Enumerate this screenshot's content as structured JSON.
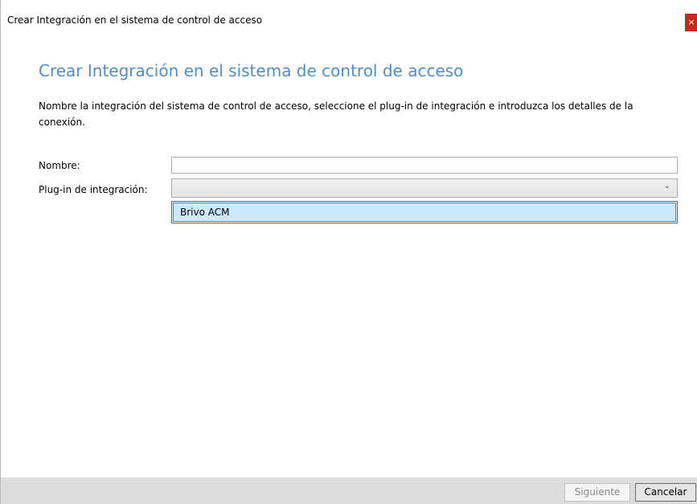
{
  "window": {
    "title": "Crear Integración en el sistema de control de acceso",
    "close_label": "×"
  },
  "page": {
    "heading": "Crear Integración en el sistema de control de acceso",
    "description": "Nombre la integración del sistema de control de acceso, seleccione el plug-in de integración e introduzca los detalles de la conexión."
  },
  "form": {
    "name_label": "Nombre:",
    "name_value": "",
    "plugin_label": "Plug-in de integración:",
    "plugin_selected": "",
    "plugin_chevron": "⌄",
    "plugin_options": [
      "Brivo ACM"
    ]
  },
  "footer": {
    "next_label": "Siguiente",
    "cancel_label": "Cancelar"
  },
  "colors": {
    "heading": "#4f8ec7",
    "close_button": "#c42b1c",
    "selected_item_bg": "#cce8ff",
    "selected_item_border": "#2e8bcd",
    "footer_bg": "#dcdcdc"
  }
}
